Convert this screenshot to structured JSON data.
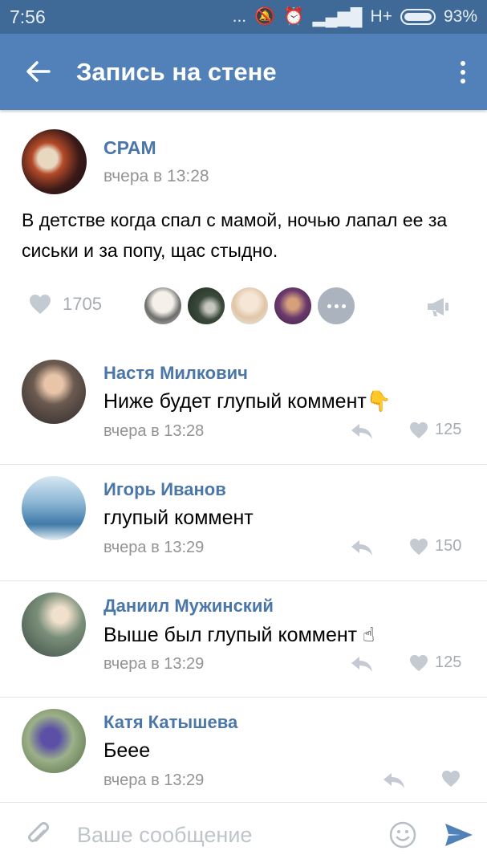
{
  "status_bar": {
    "time": "7:56",
    "indicators": "... ",
    "network": "H+",
    "battery": "93%"
  },
  "app_bar": {
    "title": "Запись на стене",
    "icons": [
      "back-arrow-icon",
      "more-vertical-icon"
    ]
  },
  "post": {
    "author": "СРАМ",
    "date": "вчера в 13:28",
    "text": "В детстве когда спал с мамой, ночью лапал ее за сиськи и за попу, щас стыдно.",
    "likes": "1705",
    "liker_avatars": 4
  },
  "comments": [
    {
      "name": "Настя Милкович",
      "text": "Ниже будет глупый коммент👇",
      "date": "вчера в 13:28",
      "likes": "125"
    },
    {
      "name": "Игорь Иванов",
      "text": "глупый коммент",
      "date": "вчера в 13:29",
      "likes": "150"
    },
    {
      "name": "Даниил Мужинский",
      "text": "Выше был глупый коммент ☝",
      "date": "вчера в 13:29",
      "likes": "125"
    },
    {
      "name": "Катя Катышева",
      "text": "Беее",
      "date": "вчера в 13:29",
      "likes": ""
    }
  ],
  "input": {
    "placeholder": "Ваше сообщение"
  },
  "colors": {
    "status_bar": "#3f6a97",
    "app_bar": "#5181b8",
    "link": "#4a76a8",
    "meta": "#939393",
    "icon_gray": "#a5acb6",
    "send": "#5181b8"
  }
}
